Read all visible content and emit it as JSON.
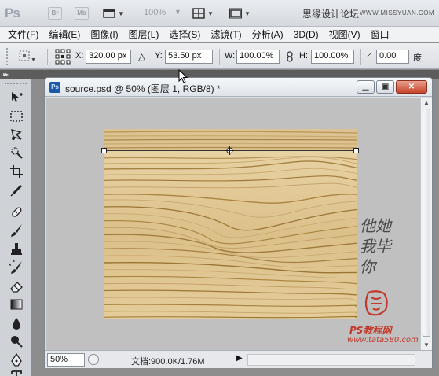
{
  "appbar": {
    "logo": "Ps",
    "bridge_label": "Br",
    "minibridge_label": "Mb",
    "zoom_display": "100%",
    "site_text": "思缘设计论坛",
    "site_url": "WWW.MISSYUAN.COM"
  },
  "menu": [
    "文件(F)",
    "编辑(E)",
    "图像(I)",
    "图层(L)",
    "选择(S)",
    "滤镜(T)",
    "分析(A)",
    "3D(D)",
    "视图(V)",
    "窗口"
  ],
  "options": {
    "x_label": "X:",
    "x_value": "320.00 px",
    "y_label": "Y:",
    "y_value": "53.50 px",
    "w_label": "W:",
    "w_value": "100.00%",
    "h_label": "H:",
    "h_value": "100.00%",
    "angle_value": "0.00",
    "angle_unit": "度"
  },
  "tools": [
    "move-tool",
    "marquee-tool",
    "lasso-tool",
    "quick-select-tool",
    "crop-tool",
    "eyedropper-tool",
    "healing-tool",
    "brush-tool",
    "clone-stamp-tool",
    "history-brush-tool",
    "eraser-tool",
    "gradient-tool",
    "blur-tool",
    "dodge-tool",
    "pen-tool",
    "type-tool"
  ],
  "document": {
    "title": "source.psd @ 50% (图层 1, RGB/8) *",
    "zoom": "50%",
    "doc_info": "文档:900.0K/1.76M",
    "watermark_text": "他她我毕你",
    "watermark_forum": "PS教程网",
    "watermark_url": "www.tata580.com"
  },
  "colors": {
    "wood_light": "#e6cf9f",
    "wood_mid": "#d2b27a",
    "wood_dark": "#a6823f",
    "canvas_bg": "#c0c0c0",
    "close_red": "#c8452a"
  }
}
